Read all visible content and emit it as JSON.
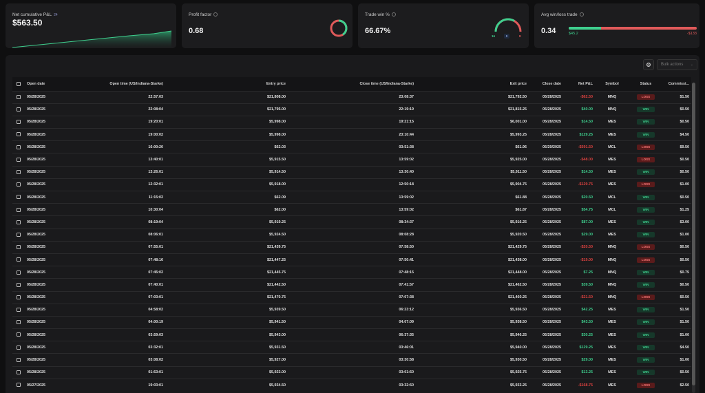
{
  "cards": {
    "net_pl": {
      "title": "Net cumulative P&L",
      "badge": "24",
      "value": "$563.50"
    },
    "profit_factor": {
      "title": "Profit factor",
      "value": "0.68",
      "ratio": 0.68
    },
    "trade_win": {
      "title": "Trade win %",
      "value": "66.67%",
      "win_count": "16",
      "neutral_count": "0",
      "loss_count": "8",
      "win_fraction": 0.6667
    },
    "avg_win_loss": {
      "title": "Avg win/loss trade",
      "value": "0.34",
      "avg_win": "$45.2",
      "avg_loss": "-$133"
    }
  },
  "toolbar": {
    "settings_icon": "gear-icon",
    "bulk_label": "Bulk actions"
  },
  "colors": {
    "win": "#3fcf8e",
    "loss": "#d9413f",
    "panel": "#1c1c1e"
  },
  "table": {
    "columns": [
      "Open date",
      "Open time (US/Indiana-Starke)",
      "Entry price",
      "Close time (US/Indiana-Starke)",
      "Exit price",
      "Close date",
      "Net P&L",
      "Symbol",
      "Status",
      "Commissi..."
    ],
    "rows": [
      {
        "open_date": "05/28/2025",
        "open_time": "22:57:03",
        "entry": "$21,808.00",
        "close_time": "23:08:37",
        "exit": "$21,792.50",
        "close_date": "05/28/2025",
        "pnl": "-$62.50",
        "pnl_sign": "neg",
        "symbol": "MNQ",
        "status": "LOSS",
        "status_type": "loss",
        "commission": "$1.50"
      },
      {
        "open_date": "05/28/2025",
        "open_time": "22:08:04",
        "entry": "$21,795.00",
        "close_time": "22:19:19",
        "exit": "$21,815.25",
        "close_date": "05/28/2025",
        "pnl": "$40.00",
        "pnl_sign": "pos",
        "symbol": "MNQ",
        "status": "WIN",
        "status_type": "win",
        "commission": "$0.50"
      },
      {
        "open_date": "05/28/2025",
        "open_time": "19:20:01",
        "entry": "$5,998.00",
        "close_time": "19:21:15",
        "exit": "$6,001.00",
        "close_date": "05/28/2025",
        "pnl": "$14.50",
        "pnl_sign": "pos",
        "symbol": "MES",
        "status": "WIN",
        "status_type": "win",
        "commission": "$0.50"
      },
      {
        "open_date": "05/28/2025",
        "open_time": "19:00:02",
        "entry": "$5,998.00",
        "close_time": "23:10:44",
        "exit": "$5,993.25",
        "close_date": "05/28/2025",
        "pnl": "$129.25",
        "pnl_sign": "pos",
        "symbol": "MES",
        "status": "WIN",
        "status_type": "win",
        "commission": "$4.50"
      },
      {
        "open_date": "05/28/2025",
        "open_time": "16:00:20",
        "entry": "$62.03",
        "close_time": "03:51:38",
        "exit": "$61.96",
        "close_date": "05/29/2025",
        "pnl": "-$591.50",
        "pnl_sign": "neg",
        "symbol": "MCL",
        "status": "LOSS",
        "status_type": "loss",
        "commission": "$9.50"
      },
      {
        "open_date": "05/28/2025",
        "open_time": "13:40:01",
        "entry": "$5,915.50",
        "close_time": "13:59:02",
        "exit": "$5,925.00",
        "close_date": "05/28/2025",
        "pnl": "-$48.00",
        "pnl_sign": "neg",
        "symbol": "MES",
        "status": "LOSS",
        "status_type": "loss",
        "commission": "$0.50"
      },
      {
        "open_date": "05/28/2025",
        "open_time": "13:26:01",
        "entry": "$5,914.50",
        "close_time": "13:30:40",
        "exit": "$5,911.50",
        "close_date": "05/28/2025",
        "pnl": "$14.50",
        "pnl_sign": "pos",
        "symbol": "MES",
        "status": "WIN",
        "status_type": "win",
        "commission": "$0.50"
      },
      {
        "open_date": "05/28/2025",
        "open_time": "12:32:01",
        "entry": "$5,918.00",
        "close_time": "12:50:18",
        "exit": "$5,904.75",
        "close_date": "05/28/2025",
        "pnl": "-$129.75",
        "pnl_sign": "neg",
        "symbol": "MES",
        "status": "LOSS",
        "status_type": "loss",
        "commission": "$1.00"
      },
      {
        "open_date": "05/28/2025",
        "open_time": "11:15:02",
        "entry": "$62.09",
        "close_time": "13:59:02",
        "exit": "$61.88",
        "close_date": "05/28/2025",
        "pnl": "$20.50",
        "pnl_sign": "pos",
        "symbol": "MCL",
        "status": "WIN",
        "status_type": "win",
        "commission": "$0.50"
      },
      {
        "open_date": "05/28/2025",
        "open_time": "10:30:04",
        "entry": "$62.00",
        "close_time": "13:59:02",
        "exit": "$61.87",
        "close_date": "05/28/2025",
        "pnl": "$54.75",
        "pnl_sign": "pos",
        "symbol": "MCL",
        "status": "WIN",
        "status_type": "win",
        "commission": "$1.25"
      },
      {
        "open_date": "05/28/2025",
        "open_time": "08:19:04",
        "entry": "$5,919.25",
        "close_time": "08:34:37",
        "exit": "$5,916.25",
        "close_date": "05/28/2025",
        "pnl": "$87.00",
        "pnl_sign": "pos",
        "symbol": "MES",
        "status": "WIN",
        "status_type": "win",
        "commission": "$3.00"
      },
      {
        "open_date": "05/28/2025",
        "open_time": "08:06:01",
        "entry": "$5,924.50",
        "close_time": "08:08:28",
        "exit": "$5,920.50",
        "close_date": "05/28/2025",
        "pnl": "$29.00",
        "pnl_sign": "pos",
        "symbol": "MES",
        "status": "WIN",
        "status_type": "win",
        "commission": "$1.00"
      },
      {
        "open_date": "05/28/2025",
        "open_time": "07:55:01",
        "entry": "$21,439.75",
        "close_time": "07:58:50",
        "exit": "$21,429.75",
        "close_date": "05/28/2025",
        "pnl": "-$20.50",
        "pnl_sign": "neg",
        "symbol": "MNQ",
        "status": "LOSS",
        "status_type": "loss",
        "commission": "$0.50"
      },
      {
        "open_date": "05/28/2025",
        "open_time": "07:48:16",
        "entry": "$21,447.25",
        "close_time": "07:50:41",
        "exit": "$21,438.00",
        "close_date": "05/28/2025",
        "pnl": "-$19.00",
        "pnl_sign": "neg",
        "symbol": "MNQ",
        "status": "LOSS",
        "status_type": "loss",
        "commission": "$0.50"
      },
      {
        "open_date": "05/28/2025",
        "open_time": "07:45:02",
        "entry": "$21,445.75",
        "close_time": "07:48:15",
        "exit": "$21,448.00",
        "close_date": "05/28/2025",
        "pnl": "$7.25",
        "pnl_sign": "pos",
        "symbol": "MNQ",
        "status": "WIN",
        "status_type": "win",
        "commission": "$0.75"
      },
      {
        "open_date": "05/28/2025",
        "open_time": "07:40:01",
        "entry": "$21,442.50",
        "close_time": "07:41:57",
        "exit": "$21,462.50",
        "close_date": "05/28/2025",
        "pnl": "$39.50",
        "pnl_sign": "pos",
        "symbol": "MNQ",
        "status": "WIN",
        "status_type": "win",
        "commission": "$0.50"
      },
      {
        "open_date": "05/28/2025",
        "open_time": "07:03:01",
        "entry": "$21,470.75",
        "close_time": "07:07:38",
        "exit": "$21,460.25",
        "close_date": "05/28/2025",
        "pnl": "-$21.50",
        "pnl_sign": "neg",
        "symbol": "MNQ",
        "status": "LOSS",
        "status_type": "loss",
        "commission": "$0.50"
      },
      {
        "open_date": "05/28/2025",
        "open_time": "04:58:02",
        "entry": "$5,939.50",
        "close_time": "06:23:12",
        "exit": "$5,936.50",
        "close_date": "05/28/2025",
        "pnl": "$42.25",
        "pnl_sign": "pos",
        "symbol": "MES",
        "status": "WIN",
        "status_type": "win",
        "commission": "$1.50"
      },
      {
        "open_date": "05/28/2025",
        "open_time": "04:00:19",
        "entry": "$5,941.50",
        "close_time": "04:07:09",
        "exit": "$5,938.50",
        "close_date": "05/28/2025",
        "pnl": "$43.50",
        "pnl_sign": "pos",
        "symbol": "MES",
        "status": "WIN",
        "status_type": "win",
        "commission": "$1.50"
      },
      {
        "open_date": "05/28/2025",
        "open_time": "03:59:03",
        "entry": "$5,943.00",
        "close_time": "06:37:35",
        "exit": "$5,946.25",
        "close_date": "05/28/2025",
        "pnl": "$30.25",
        "pnl_sign": "pos",
        "symbol": "MES",
        "status": "WIN",
        "status_type": "win",
        "commission": "$1.00"
      },
      {
        "open_date": "05/28/2025",
        "open_time": "03:32:01",
        "entry": "$5,931.50",
        "close_time": "03:46:01",
        "exit": "$5,940.00",
        "close_date": "05/28/2025",
        "pnl": "$129.25",
        "pnl_sign": "pos",
        "symbol": "MES",
        "status": "WIN",
        "status_type": "win",
        "commission": "$4.50"
      },
      {
        "open_date": "05/28/2025",
        "open_time": "03:08:02",
        "entry": "$5,927.00",
        "close_time": "03:30:58",
        "exit": "$5,930.50",
        "close_date": "05/28/2025",
        "pnl": "$29.00",
        "pnl_sign": "pos",
        "symbol": "MES",
        "status": "WIN",
        "status_type": "win",
        "commission": "$1.00"
      },
      {
        "open_date": "05/28/2025",
        "open_time": "01:53:01",
        "entry": "$5,923.00",
        "close_time": "03:01:50",
        "exit": "$5,925.75",
        "close_date": "05/28/2025",
        "pnl": "$13.25",
        "pnl_sign": "pos",
        "symbol": "MES",
        "status": "WIN",
        "status_type": "win",
        "commission": "$0.50"
      },
      {
        "open_date": "05/27/2025",
        "open_time": "19:03:01",
        "entry": "$5,934.50",
        "close_time": "03:32:50",
        "exit": "$5,933.25",
        "close_date": "05/28/2025",
        "pnl": "-$168.75",
        "pnl_sign": "neg",
        "symbol": "MES",
        "status": "LOSS",
        "status_type": "loss",
        "commission": "$2.50"
      }
    ]
  }
}
